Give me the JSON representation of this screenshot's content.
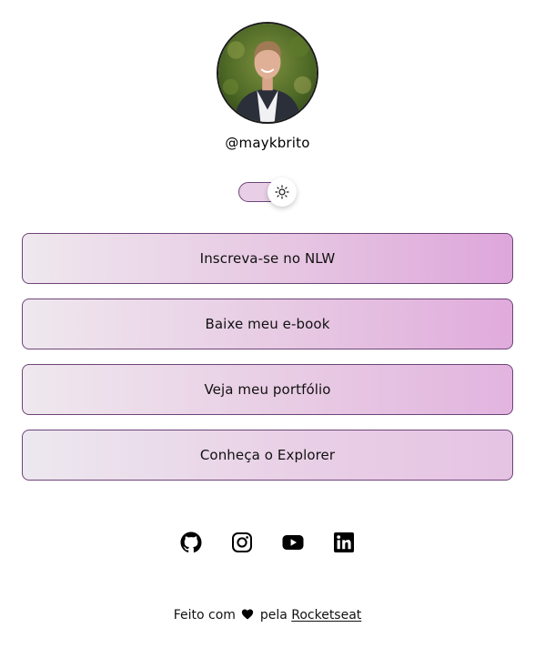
{
  "profile": {
    "username": "@maykbrito"
  },
  "theme_switch": {
    "state": "light",
    "icon": "sun-icon"
  },
  "links": [
    {
      "label": "Inscreva-se no NLW"
    },
    {
      "label": "Baixe meu e-book"
    },
    {
      "label": "Veja meu portfólio"
    },
    {
      "label": "Conheça o Explorer"
    }
  ],
  "social": [
    {
      "icon": "github-icon"
    },
    {
      "icon": "instagram-icon"
    },
    {
      "icon": "youtube-icon"
    },
    {
      "icon": "linkedin-icon"
    }
  ],
  "footer": {
    "prefix": "Feito com",
    "heart_icon": "heart-icon",
    "middle": "pela",
    "brand_link": "Rocketseat"
  },
  "colors": {
    "accent_border": "#6e4478",
    "gradient_start": "#efe8ee",
    "gradient_end": "#dea6db",
    "text": "#111111",
    "background": "#ffffff"
  }
}
